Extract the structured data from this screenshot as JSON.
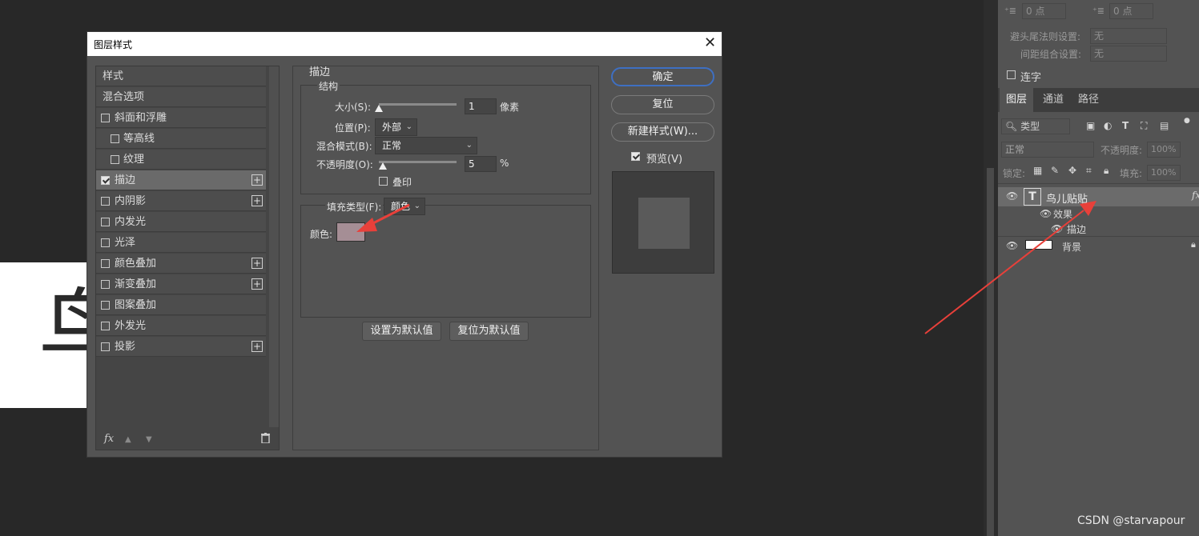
{
  "canvas": {
    "glyph": "鸟"
  },
  "dialog": {
    "title": "图层样式",
    "close_glyph": "✕",
    "styles": [
      {
        "label": "样式",
        "checkbox": false,
        "checked": false,
        "indent": false,
        "plus": false,
        "selected": false
      },
      {
        "label": "混合选项",
        "checkbox": false,
        "checked": false,
        "indent": false,
        "plus": false,
        "selected": false
      },
      {
        "label": "斜面和浮雕",
        "checkbox": true,
        "checked": false,
        "indent": false,
        "plus": false,
        "selected": false
      },
      {
        "label": "等高线",
        "checkbox": true,
        "checked": false,
        "indent": true,
        "plus": false,
        "selected": false
      },
      {
        "label": "纹理",
        "checkbox": true,
        "checked": false,
        "indent": true,
        "plus": false,
        "selected": false
      },
      {
        "label": "描边",
        "checkbox": true,
        "checked": true,
        "indent": false,
        "plus": true,
        "selected": true
      },
      {
        "label": "内阴影",
        "checkbox": true,
        "checked": false,
        "indent": false,
        "plus": true,
        "selected": false
      },
      {
        "label": "内发光",
        "checkbox": true,
        "checked": false,
        "indent": false,
        "plus": false,
        "selected": false
      },
      {
        "label": "光泽",
        "checkbox": true,
        "checked": false,
        "indent": false,
        "plus": false,
        "selected": false
      },
      {
        "label": "颜色叠加",
        "checkbox": true,
        "checked": false,
        "indent": false,
        "plus": true,
        "selected": false
      },
      {
        "label": "渐变叠加",
        "checkbox": true,
        "checked": false,
        "indent": false,
        "plus": true,
        "selected": false
      },
      {
        "label": "图案叠加",
        "checkbox": true,
        "checked": false,
        "indent": false,
        "plus": false,
        "selected": false
      },
      {
        "label": "外发光",
        "checkbox": true,
        "checked": false,
        "indent": false,
        "plus": false,
        "selected": false
      },
      {
        "label": "投影",
        "checkbox": true,
        "checked": false,
        "indent": false,
        "plus": true,
        "selected": false
      }
    ],
    "footer": {
      "fx": "fx",
      "up": "▲",
      "down": "▼",
      "trash": "🗑"
    },
    "stroke": {
      "section_title": "描边",
      "structure_title": "结构",
      "size_label": "大小(S):",
      "size_value": "1",
      "size_unit": "像素",
      "size_fraction": 0.0,
      "position_label": "位置(P):",
      "position_value": "外部",
      "blend_label": "混合模式(B):",
      "blend_value": "正常",
      "opacity_label": "不透明度(O):",
      "opacity_value": "5",
      "opacity_unit": "%",
      "opacity_fraction": 0.05,
      "overprint_label": "叠印",
      "fill_type_label": "填充类型(F):",
      "fill_type_value": "颜色",
      "color_label": "颜色:",
      "color_value": "#a58e95",
      "set_default": "设置为默认值",
      "reset_default": "复位为默认值"
    },
    "buttons": {
      "ok": "确定",
      "reset": "复位",
      "new_style": "新建样式(W)...",
      "preview_label": "预览(V)",
      "preview_checked": true
    }
  },
  "right_panel": {
    "indent_before": "0 点",
    "indent_after": "0 点",
    "kinsoku_label": "避头尾法则设置:",
    "kinsoku_value": "无",
    "mojikumi_label": "间距组合设置:",
    "mojikumi_value": "无",
    "ligature_label": "连字",
    "tabs": [
      "图层",
      "通道",
      "路径"
    ],
    "filter_label": "类型",
    "blend_mode": "正常",
    "opacity_label": "不透明度:",
    "opacity_value": "100%",
    "lock_label": "锁定:",
    "fill_label": "填充:",
    "fill_value": "100%",
    "layers": {
      "text_layer": "鸟儿贴贴",
      "text_layer_fx": "fx",
      "effects_label": "效果",
      "stroke_effect": "描边",
      "background_layer": "背景"
    }
  },
  "watermark": "CSDN @starvapour",
  "colors": {
    "accent": "#3e6fc2",
    "annotation_arrow": "#e8403a",
    "stroke_color": "#a58e95"
  }
}
